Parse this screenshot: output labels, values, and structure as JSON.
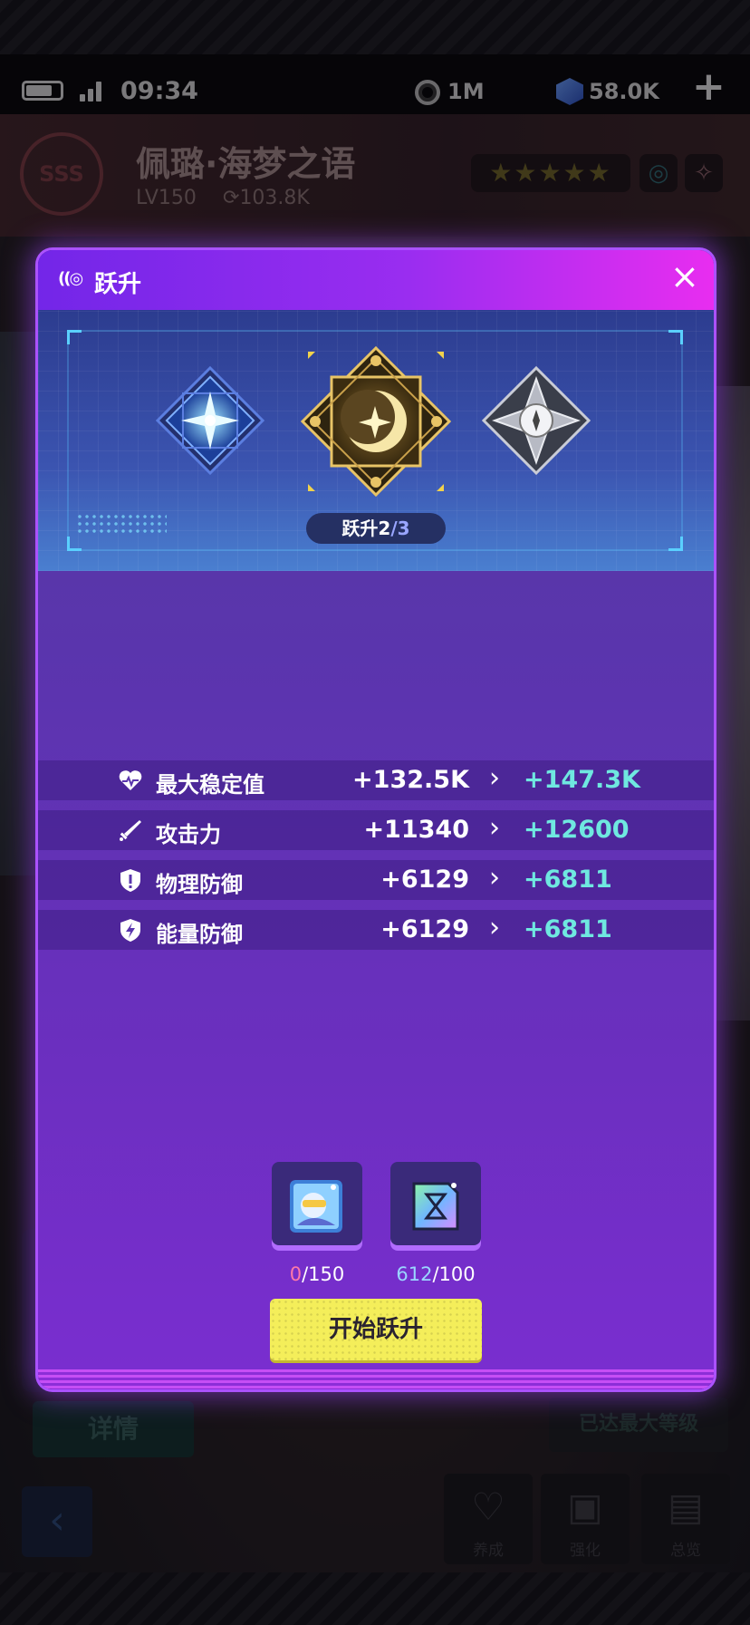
{
  "status_bar": {
    "time": "09:34",
    "coins": "1M",
    "gems": "58.0K",
    "add_icon": "+"
  },
  "hero": {
    "name": "佩璐·海梦之语",
    "level": "LV150",
    "power": "103.8K",
    "rank_badge": "SSS",
    "stars": "★★★★★",
    "element_icon": "swirl-icon",
    "class_icon": "compass-icon"
  },
  "background": {
    "details_button": "详情",
    "max_level": "已达最大等级",
    "nav": {
      "develop": "养成",
      "enhance": "强化",
      "overview": "总览"
    }
  },
  "dialog": {
    "title": "跃升",
    "close": "×",
    "ascension": {
      "label": "跃升2",
      "total": "/3"
    },
    "stats": [
      {
        "icon": "heart-icon",
        "name": "最大稳定值",
        "current": "+132.5K",
        "next": "+147.3K"
      },
      {
        "icon": "sword-icon",
        "name": "攻击力",
        "current": "+11340",
        "next": "+12600"
      },
      {
        "icon": "shield-icon",
        "name": "物理防御",
        "current": "+6129",
        "next": "+6811"
      },
      {
        "icon": "energy-shield-icon",
        "name": "能量防御",
        "current": "+6129",
        "next": "+6811"
      }
    ],
    "materials": [
      {
        "icon": "character-chip-icon",
        "have": "0",
        "need": "/150",
        "color": "#ff78a8"
      },
      {
        "icon": "hourglass-card-icon",
        "have": "612",
        "need": "/100",
        "color": "#9ad6ff"
      }
    ],
    "start_button": "开始跃升"
  },
  "colors": {
    "accent_purple": "#9a2df0",
    "next_value": "#6fe8e0",
    "button_yellow": "#f4ee5a"
  }
}
